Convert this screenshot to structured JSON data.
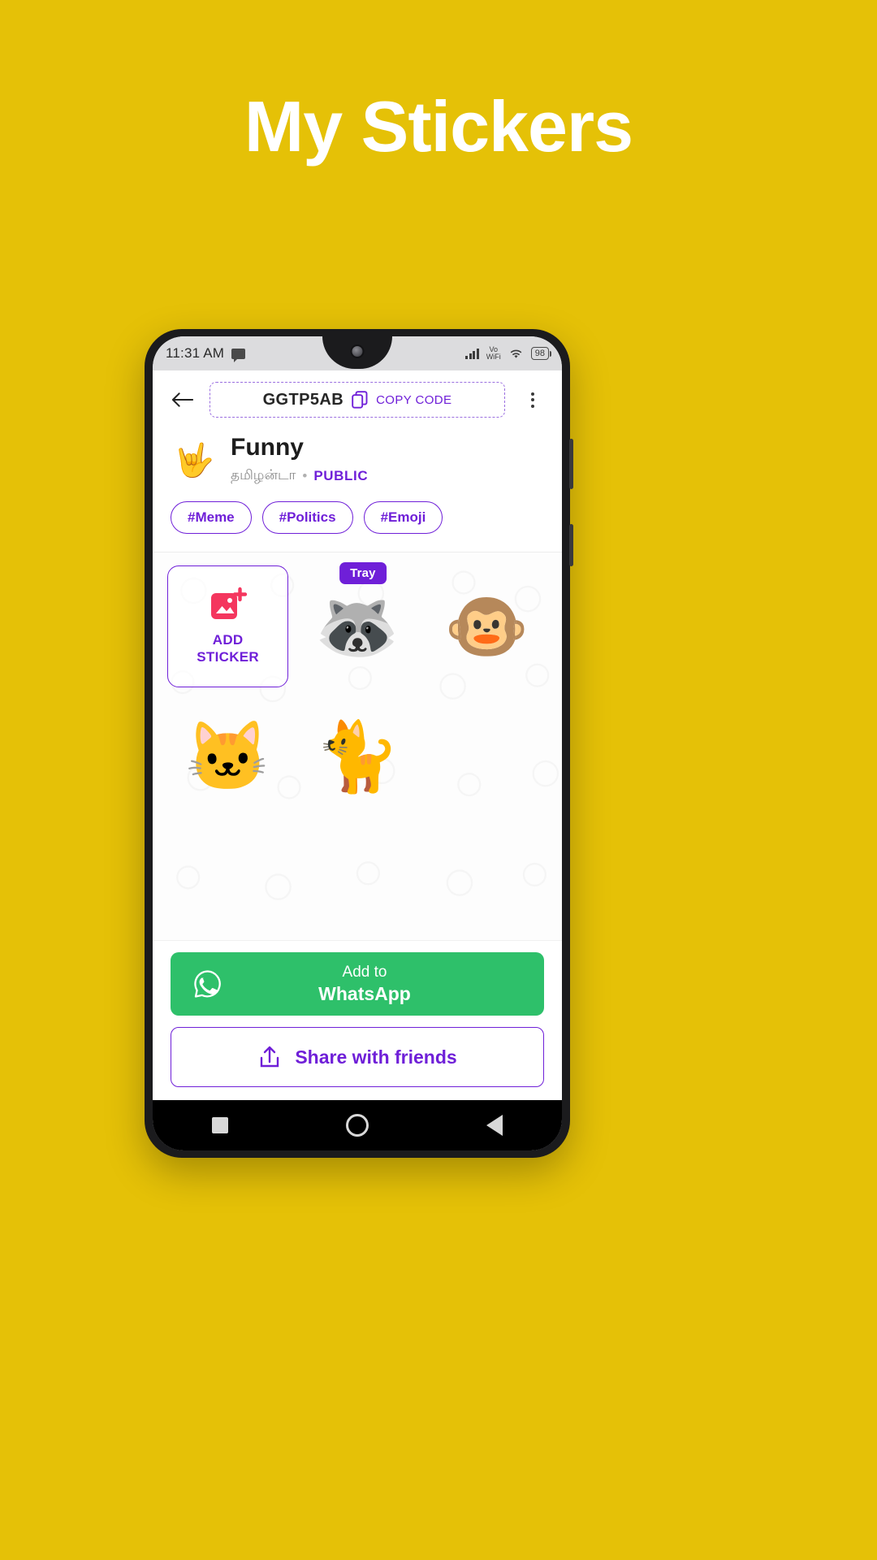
{
  "promo": {
    "headline": "My Stickers",
    "background_color": "#e5c107"
  },
  "statusbar": {
    "time": "11:31 AM",
    "message_icon": "message-icon",
    "signal_icon": "signal-bars-icon",
    "vowifi_line1": "Vo",
    "vowifi_line2": "WiFi",
    "wifi_icon": "wifi-icon",
    "battery_level": "98"
  },
  "appbar": {
    "back_icon": "back-arrow-icon",
    "code": "GGTP5AB",
    "copy_icon": "copy-icon",
    "copy_label": "COPY CODE",
    "overflow_icon": "overflow-menu-icon"
  },
  "pack": {
    "thumb_icon": "sticker-thumbnail",
    "thumb_emoji": "🤟",
    "name": "Funny",
    "author": "தமிழன்டா",
    "separator": "•",
    "visibility": "PUBLIC",
    "tags": [
      "#Meme",
      "#Politics",
      "#Emoji"
    ]
  },
  "grid": {
    "add_tile": {
      "icon": "add-image-icon",
      "label_line1": "ADD",
      "label_line2": "STICKER",
      "icon_color": "#f4365e"
    },
    "tray_badge": "Tray",
    "stickers": [
      {
        "name": "sticker-raccoon-rock",
        "emoji": "🦝"
      },
      {
        "name": "sticker-monkey-suit",
        "emoji": "🐵"
      },
      {
        "name": "sticker-cat-box",
        "emoji": "🐱"
      },
      {
        "name": "sticker-cat-peek",
        "emoji": "🐈"
      }
    ]
  },
  "actions": {
    "whatsapp_icon": "whatsapp-icon",
    "whatsapp_line1": "Add to",
    "whatsapp_line2": "WhatsApp",
    "whatsapp_color": "#2ec06a",
    "share_icon": "share-icon",
    "share_label": "Share with friends",
    "accent_color": "#6f1fd8"
  },
  "navbar": {
    "recents_icon": "recents-square-icon",
    "home_icon": "home-circle-icon",
    "back_icon": "back-triangle-icon"
  }
}
